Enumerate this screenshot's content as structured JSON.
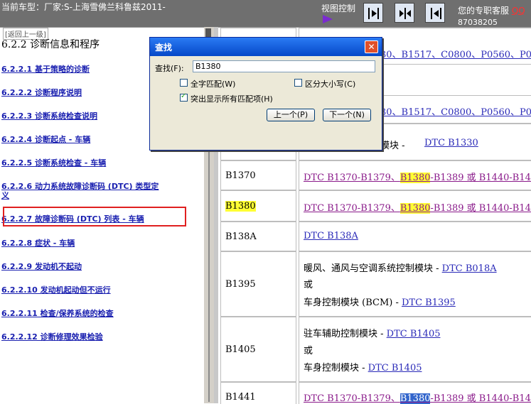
{
  "topbar": {
    "vehicle": "当前车型：厂家:S-上海雪佛兰科鲁兹2011-",
    "view_control": "视图控制",
    "support_label": "您的专职客服",
    "support_link": "QQ",
    "phone": "87038205"
  },
  "left": {
    "back_label": "[返回上一级]",
    "section_title": "6.2.2 诊断信息和程序",
    "toc": [
      "6.2.2.1 基于策略的诊断",
      "6.2.2.2 诊断程序说明",
      "6.2.2.3 诊断系统检查说明",
      "6.2.2.4 诊断起点 - 车辆",
      "6.2.2.5 诊断系统检查 - 车辆",
      "6.2.2.6 动力系统故障诊断码 (DTC) 类型定",
      "义",
      "6.2.2.7 故障诊断码 (DTC) 列表 - 车辆",
      "6.2.2.8 症状 - 车辆",
      "6.2.2.9 发动机不起动",
      "6.2.2.10 发动机起动但不运行",
      "6.2.2.11 检查/保养系统的检查",
      "6.2.2.12 诊断修理效果检验"
    ]
  },
  "table": {
    "row1_text": "30、B1517、C0800、P0560、P0",
    "row2_text": "30、B1517、C0800、P0560、P0",
    "row3_text": "模块 - ",
    "row3_link": "DTC B1330",
    "rows": [
      {
        "code": "B1370",
        "a": "DTC B1370-B1379、",
        "hl": "B1380",
        "b": "-B1389 或 B1440-B14"
      },
      {
        "code": "B1380",
        "a": "DTC B1370-B1379、",
        "hl": "B1380",
        "b": "-B1389 或 B1440-B14"
      },
      {
        "code": "B138A",
        "link": "DTC B138A"
      },
      {
        "code": "B1395",
        "l1": "暖风、通风与空调系统控制模块 - ",
        "l1link": "DTC B018A",
        "or": "或",
        "l2": "车身控制模块 (BCM) - ",
        "l2link": "DTC B1395"
      },
      {
        "code": "B1405",
        "l1": "驻车辅助控制模块 - ",
        "l1link": "DTC B1405",
        "or": "或",
        "l2": "车身控制模块 - ",
        "l2link": "DTC B1405"
      },
      {
        "code": "B1441",
        "a": "DTC B1370-B1379、",
        "hl": "B1380",
        "b": "-B1389 或 B1440-B14"
      }
    ]
  },
  "dialog": {
    "title": "查找",
    "find_label": "查找(F):",
    "find_value": "B1380",
    "whole_word": "全字匹配(W)",
    "match_case": "区分大小写(C)",
    "highlight_all": "突出显示所有匹配项(H)",
    "prev": "上一个(P)",
    "next": "下一个(N)"
  },
  "colors": {
    "highlight": "#ffff33",
    "toc_link": "#1a20b0",
    "red_box": "#e02020"
  }
}
